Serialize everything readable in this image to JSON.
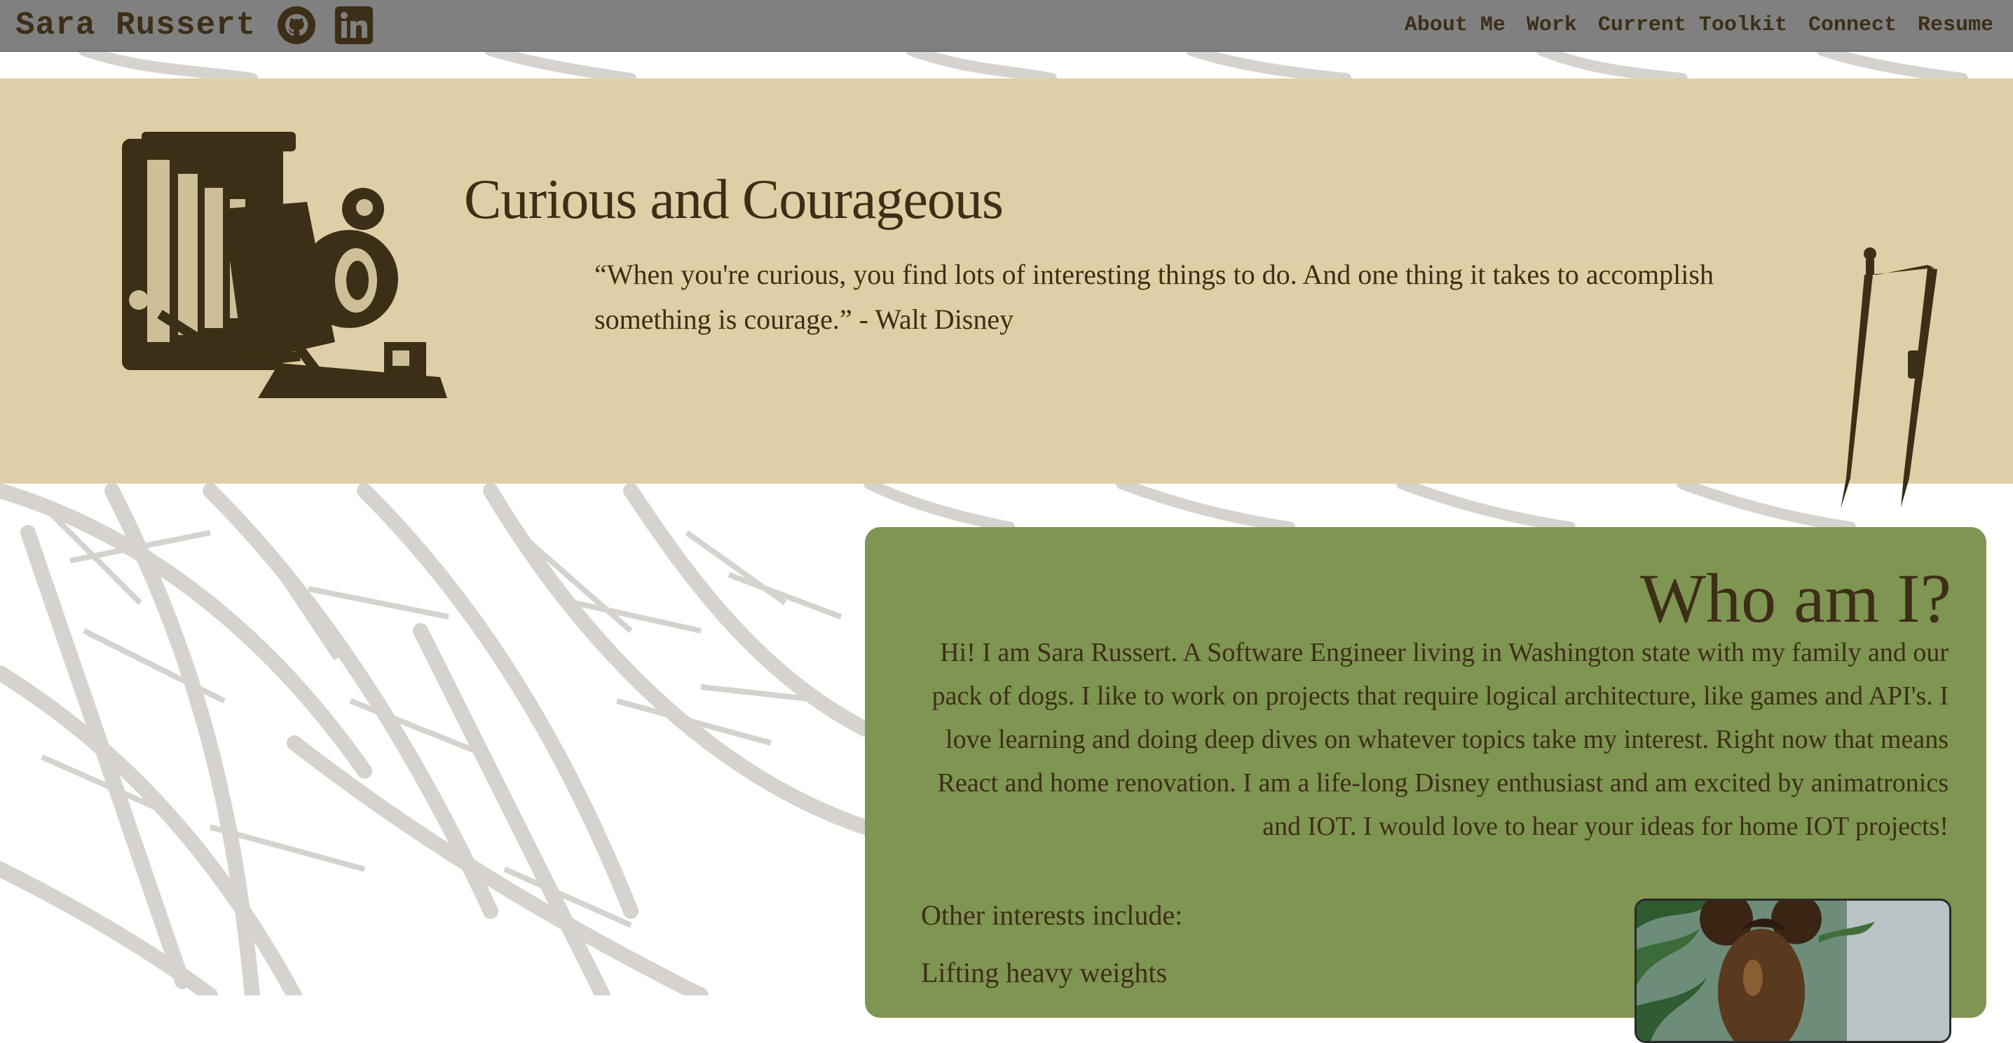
{
  "navbar": {
    "brand": "Sara Russert",
    "github_icon": "github-icon",
    "linkedin_icon": "linkedin-icon",
    "links": [
      "About Me",
      "Work",
      "Current Toolkit",
      "Connect",
      "Resume"
    ]
  },
  "hero": {
    "title": "Curious and Courageous",
    "quote": "“When you're curious, you find lots of interesting things to do. And one thing it takes to accomplish something is courage.” - Walt Disney",
    "left_illustration": "vintage-camera",
    "right_illustration": "drafting-compass"
  },
  "about": {
    "title": "Who am I?",
    "body": "Hi! I am Sara Russert. A Software Engineer living in Washington state with my family and our pack of dogs. I like to work on projects that require logical architecture, like games and API's. I love learning and doing deep dives on whatever topics take my interest. Right now that means React and home renovation. I am a life-long Disney enthusiast and am excited by animatronics and IOT. I would love to hear your ideas for home IOT projects!",
    "interests_heading": "Other interests include:",
    "interests": [
      "Lifting heavy weights"
    ]
  },
  "colors": {
    "navbar": "#808080",
    "hero_bg": "#decfa6",
    "card_bg": "#7f9552",
    "text": "#3d2e17",
    "leaf_pattern": "#d3d0cc"
  }
}
